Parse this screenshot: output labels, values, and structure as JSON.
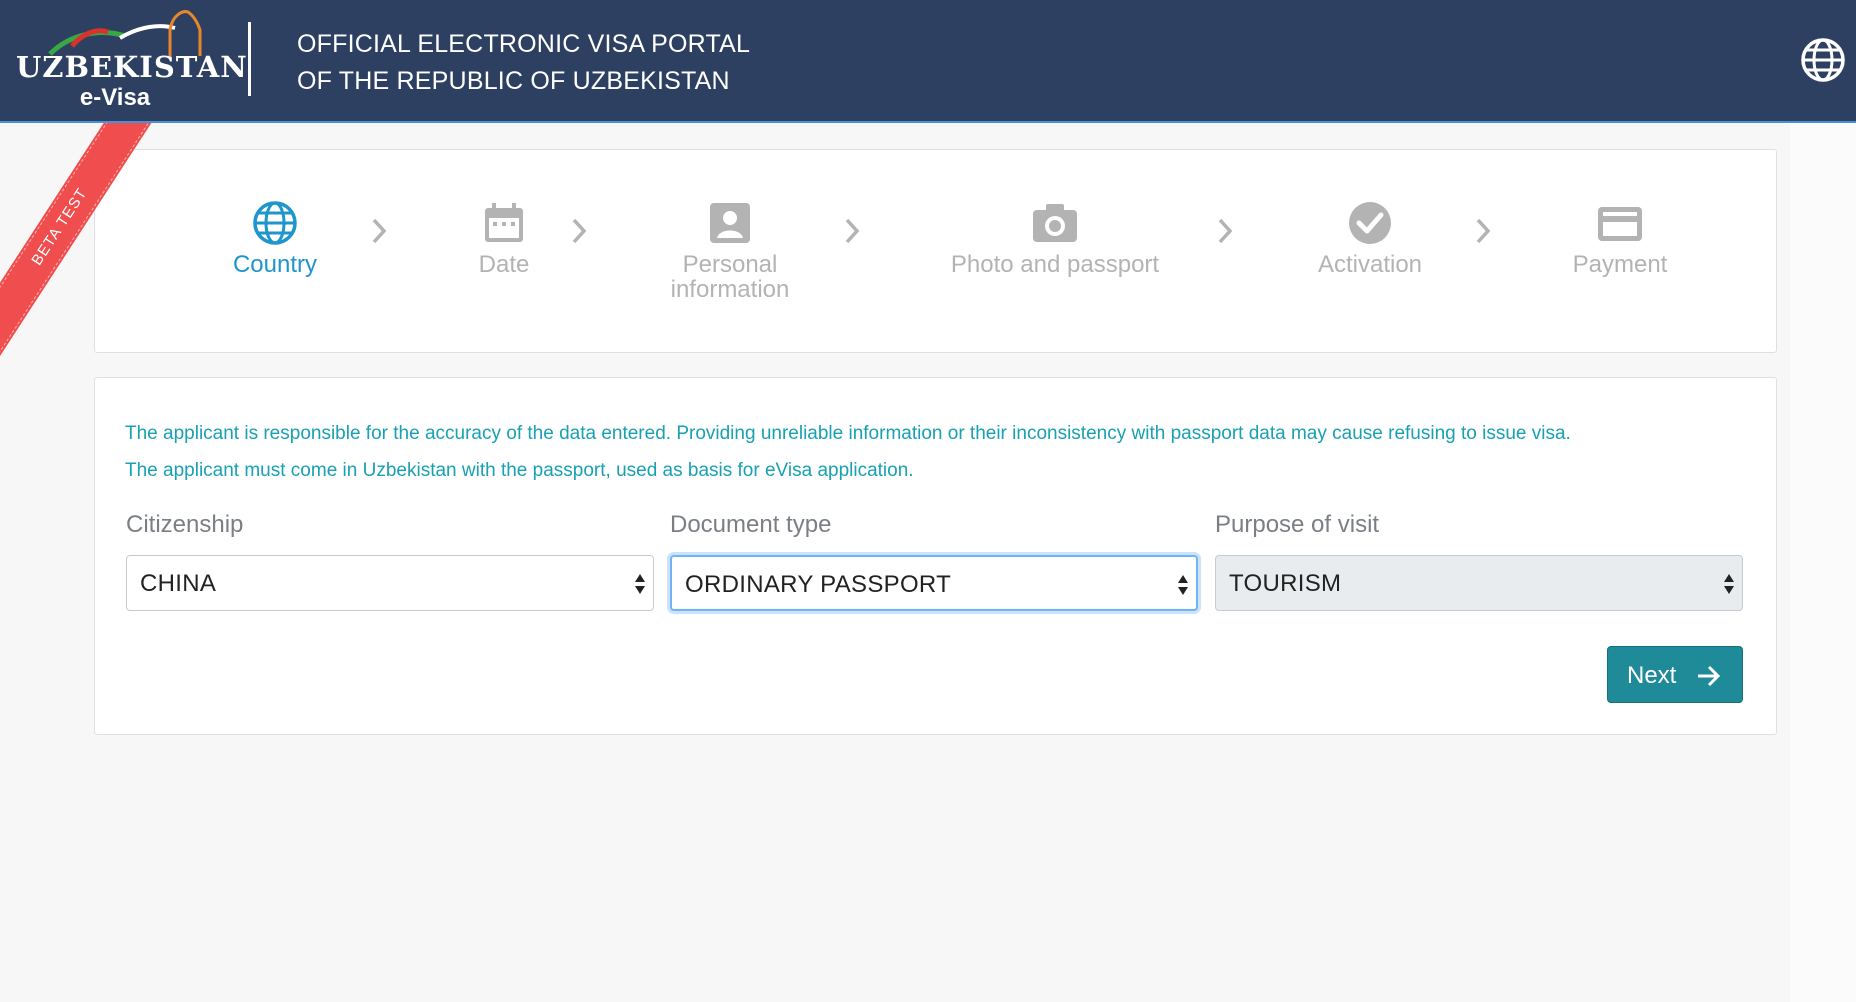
{
  "header": {
    "logo_word": "UZBEKISTAN",
    "logo_sub": "e-Visa",
    "title_line1": "OFFICIAL ELECTRONIC VISA PORTAL",
    "title_line2": "OF THE REPUBLIC OF UZBEKISTAN",
    "language_icon": "globe-icon"
  },
  "ribbon": {
    "label": "BETA TEST"
  },
  "steps": [
    {
      "label": "Country",
      "icon": "globe-icon",
      "active": true
    },
    {
      "label": "Date",
      "icon": "calendar-icon",
      "active": false
    },
    {
      "label_line1": "Personal",
      "label_line2": "information",
      "icon": "person-icon",
      "active": false
    },
    {
      "label": "Photo and passport",
      "icon": "camera-icon",
      "active": false
    },
    {
      "label": "Activation",
      "icon": "check-circle-icon",
      "active": false
    },
    {
      "label": "Payment",
      "icon": "credit-card-icon",
      "active": false
    }
  ],
  "notice": {
    "line1": "The applicant is responsible for the accuracy of the data entered. Providing unreliable information or their inconsistency with passport data may cause refusing to issue visa.",
    "line2": "The applicant must come in Uzbekistan with the passport, used as basis for eVisa application."
  },
  "form": {
    "citizenship": {
      "label": "Citizenship",
      "value": "CHINA"
    },
    "document_type": {
      "label": "Document type",
      "value": "ORDINARY PASSPORT"
    },
    "purpose": {
      "label": "Purpose of visit",
      "value": "TOURISM"
    },
    "next_label": "Next"
  },
  "colors": {
    "header_bg": "#2e4061",
    "accent_blue": "#1e96cc",
    "notice_teal": "#18a1b3",
    "button_teal": "#1f8a98",
    "ribbon_red": "#f04e4e",
    "inactive_gray": "#b3b3b3"
  }
}
